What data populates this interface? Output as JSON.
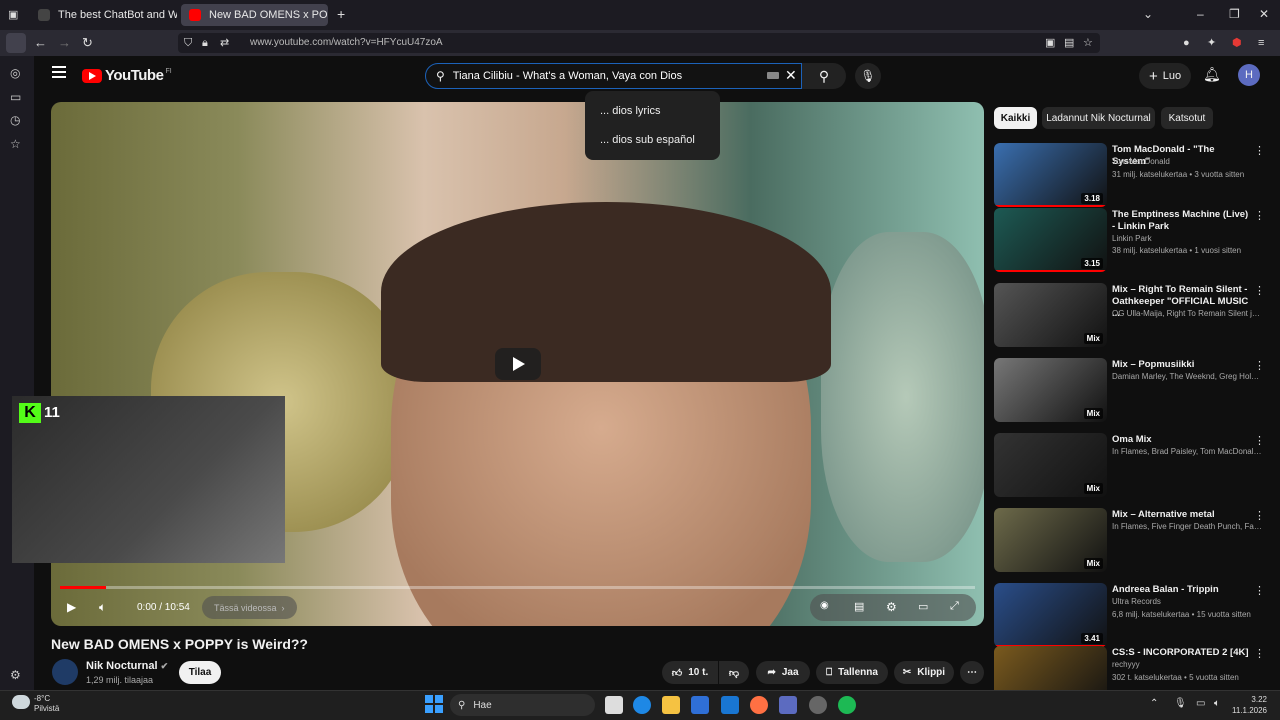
{
  "browser": {
    "tabs": [
      {
        "label": "The best ChatBot and Wid",
        "icon_color": "#444"
      },
      {
        "label": "New BAD OMENS x POPPY is W",
        "icon_color": "#ff0000"
      }
    ],
    "url": "www.youtube.com/watch?v=HFYcuU47zoA"
  },
  "youtube": {
    "logo": "YouTube",
    "region": "FI",
    "search_query": "Tiana Cilibiu - What's a Woman, Vaya con Dios",
    "suggestions": [
      "... dios lyrics",
      "... dios sub español"
    ],
    "create_label": "Luo",
    "avatar_letter": "H"
  },
  "player": {
    "time": "0:00 / 10:54",
    "chapter": "Tässä videossa",
    "progress_fraction": 0.05,
    "stream_overlay": {
      "platform_letter": "K",
      "count": "11"
    }
  },
  "video": {
    "title": "New BAD OMENS x POPPY is Weird??",
    "channel": "Nik Nocturnal",
    "subscribers": "1,29 milj. tilaajaa",
    "subscribe_label": "Tilaa",
    "likes": "10 t.",
    "share": "Jaa",
    "save": "Tallenna",
    "clip": "Klippi"
  },
  "chips": [
    "Kaikki",
    "Ladannut Nik Nocturnal",
    "Katsotut"
  ],
  "recommendations": [
    {
      "title": "Tom MacDonald - \"The System\"",
      "channel": "Tom MacDonald",
      "meta": "31 milj. katselukertaa • 3 vuotta sitten",
      "badge": "3.18",
      "color": "#3a6fb0"
    },
    {
      "title": "The Emptiness Machine (Live) - Linkin Park",
      "channel": "Linkin Park",
      "meta": "38 milj. katselukertaa • 1 vuosi sitten",
      "badge": "3.15",
      "color": "#1d5a54"
    },
    {
      "title": "Mix – Right To Remain Silent - Oathkeeper \"OFFICIAL MUSIC ...",
      "channel": "OG Ulla-Maija, Right To Remain Silent ja ...",
      "meta": "",
      "badge": "Mix",
      "color": "#555"
    },
    {
      "title": "Mix – Popmusiikki",
      "channel": "Damian Marley, The Weeknd, Greg Holde...",
      "meta": "",
      "badge": "Mix",
      "color": "#777"
    },
    {
      "title": "Oma Mix",
      "channel": "In Flames, Brad Paisley, Tom MacDonald...",
      "meta": "",
      "badge": "Mix",
      "color": "#333"
    },
    {
      "title": "Mix – Alternative metal",
      "channel": "In Flames, Five Finger Death Punch, Falli...",
      "meta": "",
      "badge": "Mix",
      "color": "#6d6a4a"
    },
    {
      "title": "Andreea Balan - Trippin",
      "channel": "Ultra Records",
      "meta": "6,8 milj. katselukertaa • 15 vuotta sitten",
      "badge": "3.41",
      "color": "#2a4e8a"
    },
    {
      "title": "CS:S - INCORPORATED 2 [4K]",
      "channel": "rechyyy",
      "meta": "302 t. katselukertaa • 5 vuotta sitten",
      "badge": "",
      "color": "#7a5a1e"
    }
  ],
  "taskbar": {
    "search": "Hae",
    "temp": "-8°C",
    "weather": "Pilvistä",
    "time": "3.22",
    "date": "11.1.2026"
  }
}
